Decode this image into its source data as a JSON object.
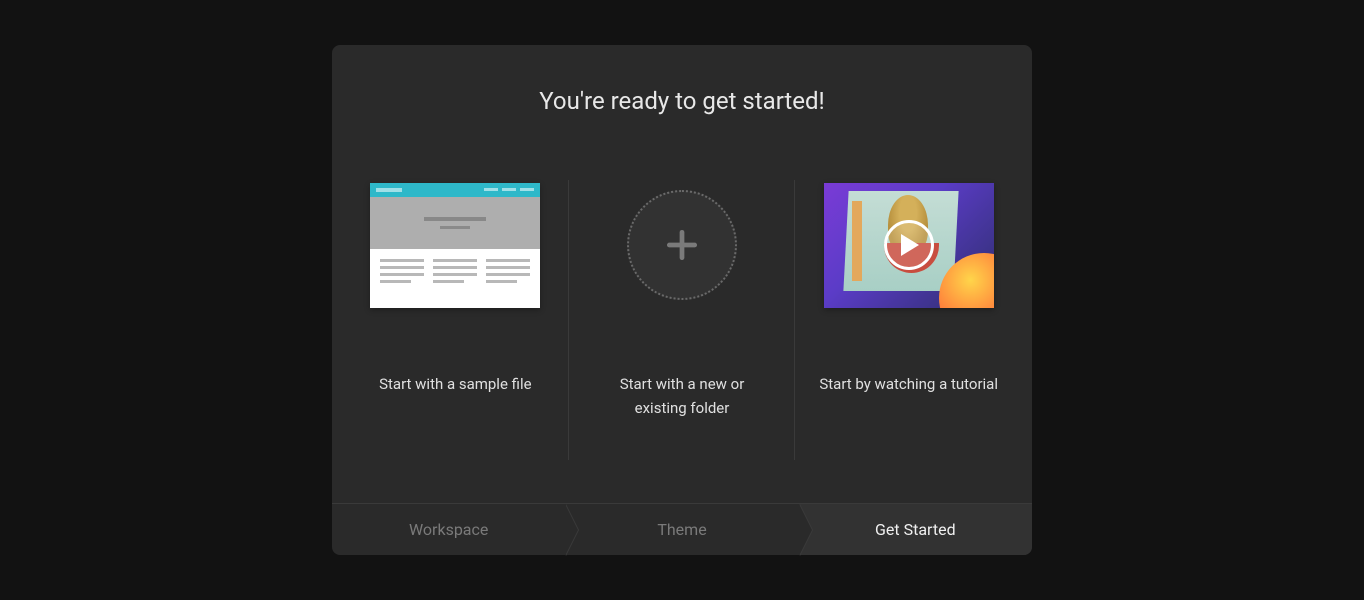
{
  "dialog": {
    "title": "You're ready to get started!"
  },
  "options": {
    "sample": {
      "label": "Start with a sample file"
    },
    "folder": {
      "label": "Start with a new or existing folder"
    },
    "tutorial": {
      "label": "Start by watching a tutorial"
    }
  },
  "steps": {
    "workspace": "Workspace",
    "theme": "Theme",
    "get_started": "Get Started"
  }
}
